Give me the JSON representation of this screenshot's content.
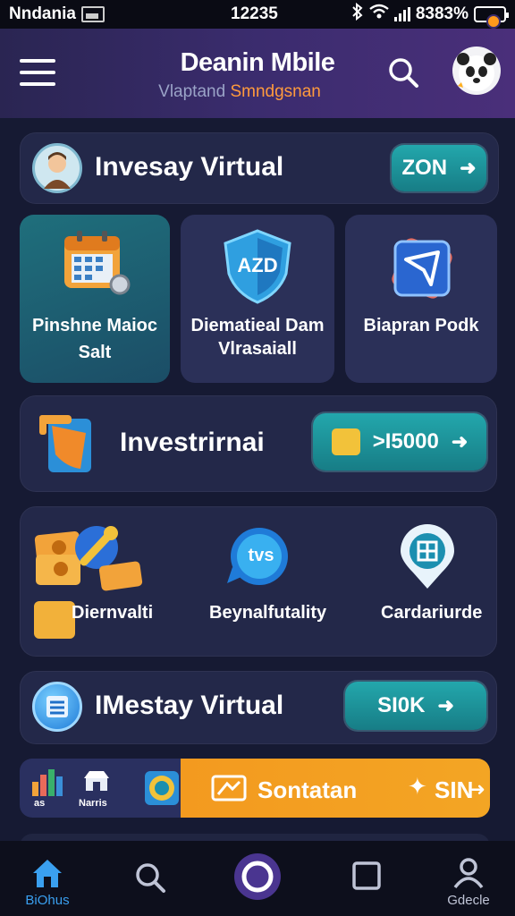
{
  "status_bar": {
    "carrier": "Nndania",
    "time": "12235",
    "battery": "8383%"
  },
  "header": {
    "title": "Deanin Mbile",
    "subtitle_a": "Vlaptand",
    "subtitle_b": "Smndgsnan"
  },
  "row1": {
    "title": "Invesay Virtual",
    "button": "ZON"
  },
  "tiles": [
    {
      "label_line1": "Pinshne Maioc",
      "label_line2": "Salt",
      "icon": "calendar-icon"
    },
    {
      "label_line1": "Diematieal Dam",
      "label_line2": "Vlrasaiall",
      "icon": "shield-icon",
      "icon_text": "AZD"
    },
    {
      "label_line1": "Biapran Podk",
      "label_line2": "",
      "icon": "send-icon"
    }
  ],
  "row2": {
    "title": "Investrirnai",
    "button": ">I5000"
  },
  "features": [
    {
      "label": "Diernvalti",
      "icon": "money-icon"
    },
    {
      "label": "Beynalfutality",
      "icon": "chat-icon",
      "icon_text": "tvs"
    },
    {
      "label": "Cardariurde",
      "icon": "location-icon"
    }
  ],
  "row3": {
    "title": "IMestay Virtual",
    "button": "SI0K"
  },
  "promo": {
    "mini_a": "as",
    "mini_b": "Narris",
    "main_text": "Sontatan",
    "right_text": "SIN"
  },
  "bottom_nav": {
    "items": [
      {
        "label": "BiOhus",
        "icon": "home-icon"
      },
      {
        "label": "",
        "icon": "search-icon"
      },
      {
        "label": "",
        "icon": "circle-icon"
      },
      {
        "label": "",
        "icon": "square-icon"
      },
      {
        "label": "Gdecle",
        "icon": "profile-icon"
      }
    ]
  },
  "colors": {
    "background": "#161a33",
    "accent_teal": "#1f9aa0",
    "accent_orange": "#f39a1f",
    "header_purple": "#3b2c6e"
  }
}
